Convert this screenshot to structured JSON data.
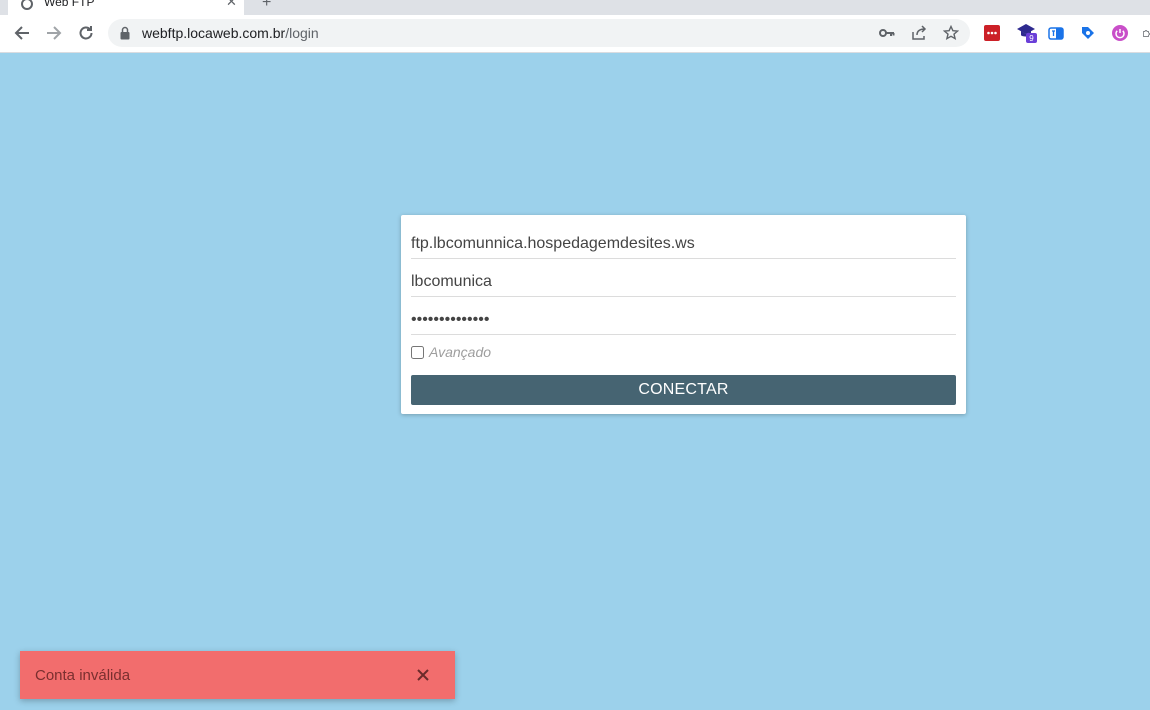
{
  "browser": {
    "tab_title": "Web FTP",
    "url_host": "webftp.locaweb.com.br",
    "url_path": "/login",
    "extension_badge": "9"
  },
  "form": {
    "host_value": "ftp.lbcomunnica.hospedagemdesites.ws",
    "user_value": "lbcomunica",
    "password_value": "••••••••••••••",
    "advanced_label": "Avançado",
    "connect_label": "CONECTAR"
  },
  "toast": {
    "message": "Conta inválida"
  },
  "colors": {
    "background": "#9cd1eb",
    "button": "#466472",
    "toast": "#f26d6d"
  }
}
